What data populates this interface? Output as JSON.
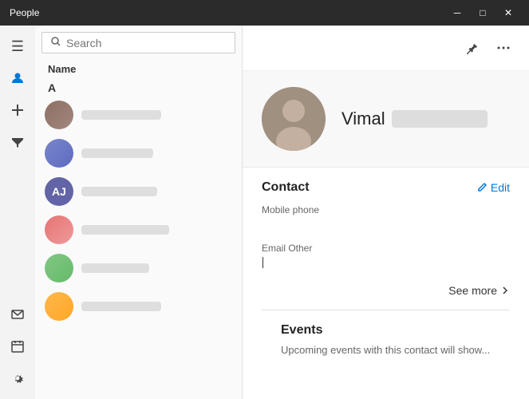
{
  "titlebar": {
    "title": "People",
    "min_label": "─",
    "max_label": "□",
    "close_label": "✕"
  },
  "sidebar": {
    "icons": [
      {
        "name": "hamburger-icon",
        "symbol": "☰",
        "active": false
      },
      {
        "name": "person-icon",
        "symbol": "👤",
        "active": true
      },
      {
        "name": "add-icon",
        "symbol": "＋",
        "active": false
      },
      {
        "name": "filter-icon",
        "symbol": "⧖",
        "active": false
      }
    ],
    "bottom_icons": [
      {
        "name": "mail-icon",
        "symbol": "✉"
      },
      {
        "name": "calendar-icon",
        "symbol": "📅"
      },
      {
        "name": "settings-icon",
        "symbol": "⚙"
      }
    ]
  },
  "search": {
    "placeholder": "Search",
    "value": ""
  },
  "list": {
    "name_label": "Name",
    "section_letter": "A",
    "contacts": [
      {
        "id": 1,
        "initials": "",
        "blur_width": 100
      },
      {
        "id": 2,
        "initials": "",
        "blur_width": 90
      },
      {
        "id": 3,
        "initials": "AJ",
        "blur_width": 95
      },
      {
        "id": 4,
        "initials": "",
        "blur_width": 110
      },
      {
        "id": 5,
        "initials": "",
        "blur_width": 85
      },
      {
        "id": 6,
        "initials": "",
        "blur_width": 100
      }
    ]
  },
  "detail": {
    "header_icons": [
      {
        "name": "pin-icon",
        "symbol": "📌"
      },
      {
        "name": "more-icon",
        "symbol": "···"
      }
    ],
    "hero": {
      "first_name": "Vimal"
    },
    "contact_section": {
      "title": "Contact",
      "edit_label": "Edit",
      "fields": [
        {
          "label": "Mobile phone",
          "value": "",
          "has_cursor": false
        },
        {
          "label": "Email Other",
          "value": "",
          "has_cursor": true
        }
      ]
    },
    "see_more_label": "See more",
    "events_section": {
      "title": "Events",
      "description": "Upcoming events with this contact will show..."
    }
  }
}
